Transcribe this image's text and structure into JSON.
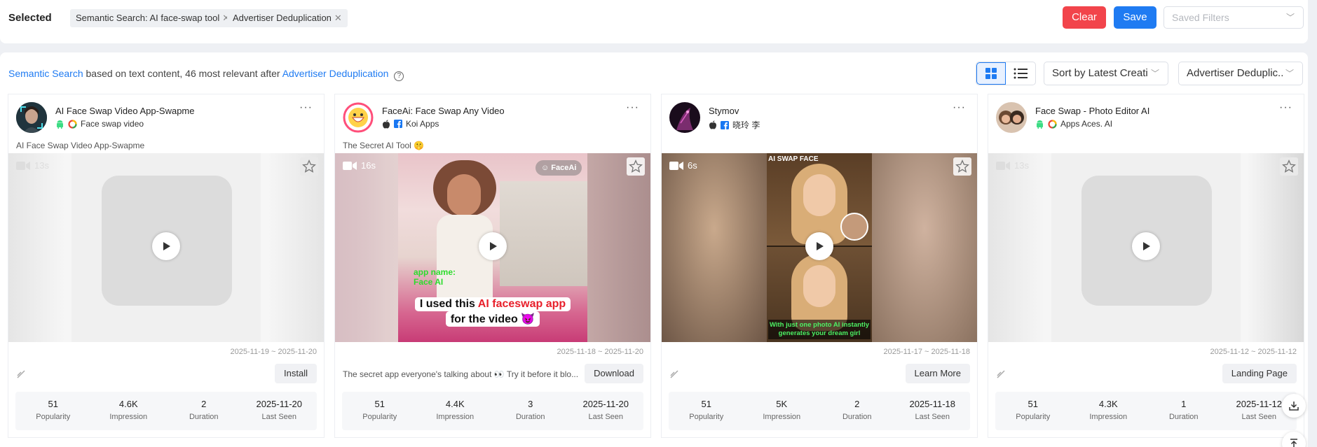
{
  "filters": {
    "selected_label": "Selected",
    "chips": [
      "Semantic Search: AI face-swap tool",
      "Advertiser Deduplication"
    ],
    "clear_label": "Clear",
    "save_label": "Save",
    "saved_filters_placeholder": "Saved Filters"
  },
  "summary": {
    "semantic_link": "Semantic Search",
    "text_mid": " based on text content, ",
    "count": "46",
    "text_after": " most relevant after ",
    "dedup_link": "Advertiser Deduplication"
  },
  "toolbar": {
    "sort_value": "Sort by Latest Creati...",
    "dedup_value": "Advertiser Deduplic..."
  },
  "colors": {
    "accent": "#1f7bf2",
    "danger": "#f2444b"
  },
  "stat_labels": [
    "Popularity",
    "Impression",
    "Duration",
    "Last Seen"
  ],
  "cards": [
    {
      "app_name": "AI Face Swap Video App-Swapme",
      "advertiser": "Face swap video",
      "platforms": [
        "android-icon",
        "google-ads-icon"
      ],
      "caption": "AI Face Swap Video App-Swapme",
      "duration": "13s",
      "date_range": "2025-11-19 ~ 2025-11-20",
      "description": "",
      "cta": "Install",
      "stats": [
        "51",
        "4.6K",
        "2",
        "2025-11-20"
      ]
    },
    {
      "app_name": "FaceAi: Face Swap Any Video",
      "advertiser": "Koi Apps",
      "platforms": [
        "apple-icon",
        "facebook-icon"
      ],
      "caption": "The Secret AI Tool 🤫",
      "duration": "16s",
      "date_range": "2025-11-18 ~ 2025-11-20",
      "description": "The secret app everyone's talking about 👀 Try it before it blo...",
      "cta": "Download",
      "stats": [
        "51",
        "4.4K",
        "3",
        "2025-11-20"
      ],
      "overlay_brand": "FaceAi",
      "overlay_app_name": "app name:",
      "overlay_app_name2": "Face AI",
      "overlay_line1a": "I used this ",
      "overlay_line1b": "AI faceswap app",
      "overlay_line2": "for the video 😈"
    },
    {
      "app_name": "Stymov",
      "advertiser": "晓玲 李",
      "platforms": [
        "apple-icon",
        "facebook-icon"
      ],
      "caption": "",
      "duration": "6s",
      "date_range": "2025-11-17 ~ 2025-11-18",
      "description": "",
      "cta": "Learn More",
      "stats": [
        "51",
        "5K",
        "2",
        "2025-11-18"
      ],
      "overlay_top": "AI SWAP FACE",
      "overlay_bottom": "With just one photo AI instantly generates your dream girl"
    },
    {
      "app_name": "Face Swap - Photo Editor AI",
      "advertiser": "Apps Aces. AI",
      "platforms": [
        "android-icon",
        "google-ads-icon"
      ],
      "caption": "",
      "duration": "13s",
      "date_range": "2025-11-12 ~ 2025-11-12",
      "description": "",
      "cta": "Landing Page",
      "stats": [
        "51",
        "4.3K",
        "1",
        "2025-11-12"
      ]
    }
  ]
}
